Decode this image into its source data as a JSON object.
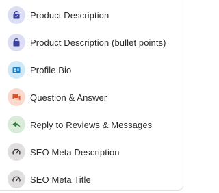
{
  "menu": {
    "items": [
      {
        "label": "Product Description",
        "icon": "shopping-bag-icon",
        "icon_bg": "#dcdef4",
        "icon_color": "#3b3f9a"
      },
      {
        "label": "Product Description (bullet points)",
        "icon": "shopping-bag-icon",
        "icon_bg": "#dcdef4",
        "icon_color": "#3b3f9a"
      },
      {
        "label": "Profile Bio",
        "icon": "id-card-icon",
        "icon_bg": "#cfe9f8",
        "icon_color": "#1f7fc0"
      },
      {
        "label": "Question & Answer",
        "icon": "chat-bubbles-icon",
        "icon_bg": "#fbd9cf",
        "icon_color": "#d8532c"
      },
      {
        "label": "Reply to Reviews & Messages",
        "icon": "reply-arrow-icon",
        "icon_bg": "#d9ecd9",
        "icon_color": "#3d7a3d"
      },
      {
        "label": "SEO Meta Description",
        "icon": "gauge-icon",
        "icon_bg": "#e0dede",
        "icon_color": "#3a3a3a"
      },
      {
        "label": "SEO Meta Title",
        "icon": "gauge-icon",
        "icon_bg": "#e0dede",
        "icon_color": "#3a3a3a"
      }
    ]
  }
}
